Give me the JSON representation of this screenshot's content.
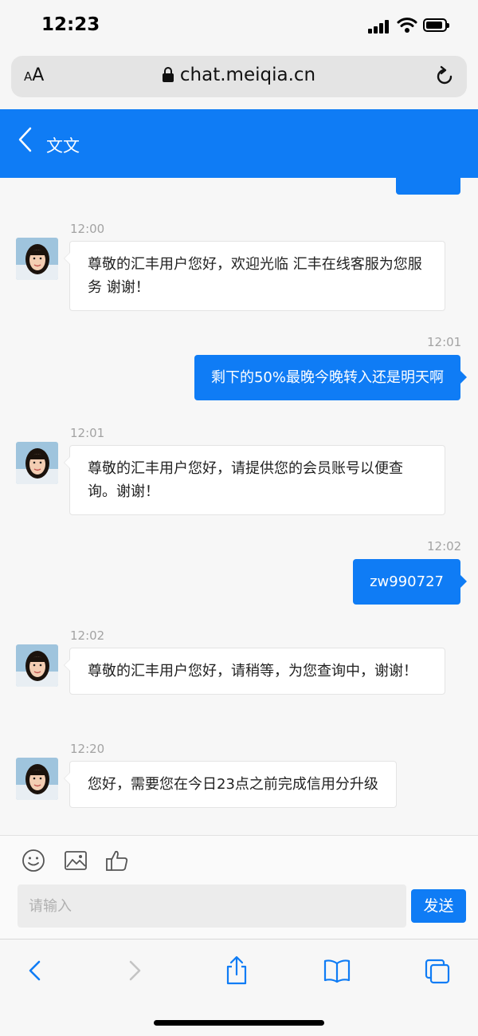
{
  "status_bar": {
    "time": "12:23"
  },
  "browser": {
    "text_size_label_small": "A",
    "text_size_label_large": "A",
    "url": "chat.meiqia.cn"
  },
  "header": {
    "title": "文文"
  },
  "messages": [
    {
      "direction": "in",
      "time": "12:00",
      "text": "尊敬的汇丰用户您好，欢迎光临 汇丰在线客服为您服务 谢谢！"
    },
    {
      "direction": "out",
      "time": "12:01",
      "text": "剩下的50%最晚今晚转入还是明天啊"
    },
    {
      "direction": "in",
      "time": "12:01",
      "text": "尊敬的汇丰用户您好，请提供您的会员账号以便查询。谢谢！"
    },
    {
      "direction": "out",
      "time": "12:02",
      "text": "zw990727"
    },
    {
      "direction": "in",
      "time": "12:02",
      "text": "尊敬的汇丰用户您好，请稍等，为您查询中，谢谢！"
    },
    {
      "direction": "in",
      "time": "12:20",
      "text": "您好，需要您在今日23点之前完成信用分升级"
    }
  ],
  "composer": {
    "tools": [
      "emoji-icon",
      "image-icon",
      "thumbs-up-icon"
    ],
    "placeholder": "请输入",
    "send_label": "发送"
  },
  "toolbar": {
    "icons": [
      "back-icon",
      "forward-icon",
      "share-icon",
      "bookmarks-icon",
      "tabs-icon"
    ]
  },
  "colors": {
    "accent": "#0f7cf5",
    "background": "#f7f7f7"
  }
}
